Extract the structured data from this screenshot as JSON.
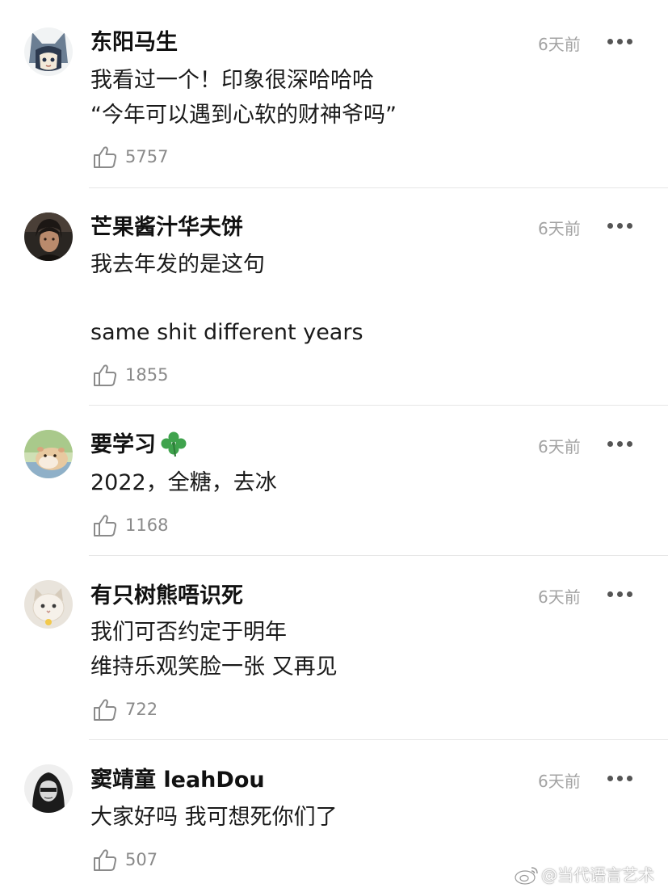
{
  "comments": [
    {
      "username": "东阳马生",
      "time": "6天前",
      "lines": [
        "我看过一个！印象很深哈哈哈",
        "“今年可以遇到心软的财神爷吗”"
      ],
      "likes": "5757",
      "avatar": "cat-ear-hood-avatar"
    },
    {
      "username": "芒果酱汁华夫饼",
      "time": "6天前",
      "lines": [
        "我去年发的是这句",
        "",
        "same shit different years"
      ],
      "likes": "1855",
      "avatar": "man-photo-avatar"
    },
    {
      "username": "要学习",
      "time": "6天前",
      "lines": [
        "2022，全糖，去冰"
      ],
      "likes": "1168",
      "avatar": "hamster-avatar",
      "emoji": "clover-icon"
    },
    {
      "username": "有只树熊唔识死",
      "time": "6天前",
      "lines": [
        "我们可否约定于明年",
        "维持乐观笑脸一张 又再见"
      ],
      "likes": "722",
      "avatar": "cat-avatar"
    },
    {
      "username": "窦靖童 leahDou",
      "time": "6天前",
      "lines": [
        "大家好吗 我可想死你们了"
      ],
      "likes": "507",
      "avatar": "bw-portrait-avatar"
    }
  ],
  "watermark": {
    "text": "@当代语言艺术",
    "icon": "weibo-logo-icon"
  },
  "colors": {
    "time": "#a3a3a3",
    "like": "#8a8a8a",
    "divider": "#e6e6e6",
    "clover": "#3fa34d"
  }
}
